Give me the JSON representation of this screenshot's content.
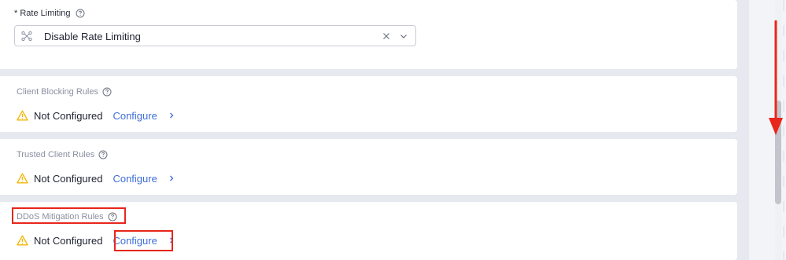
{
  "rate_limiting": {
    "label": "* Rate Limiting",
    "selected_value": "Disable Rate Limiting"
  },
  "sections": {
    "client_blocking": {
      "title": "Client Blocking Rules",
      "status": "Not Configured",
      "action": "Configure"
    },
    "trusted_client": {
      "title": "Trusted Client Rules",
      "status": "Not Configured",
      "action": "Configure"
    },
    "ddos": {
      "title": "DDoS Mitigation Rules",
      "status": "Not Configured",
      "action": "Configure"
    }
  },
  "colors": {
    "accent_link": "#3f6fd8",
    "warning": "#f2b705",
    "annotation": "#e8261c"
  },
  "icons": {
    "select_icon": "network-icon",
    "help": "help-circle-icon",
    "warning": "warning-triangle-icon",
    "clear": "clear-icon",
    "dropdown": "chevron-down-icon",
    "configure_arrow": "chevron-right-icon"
  }
}
